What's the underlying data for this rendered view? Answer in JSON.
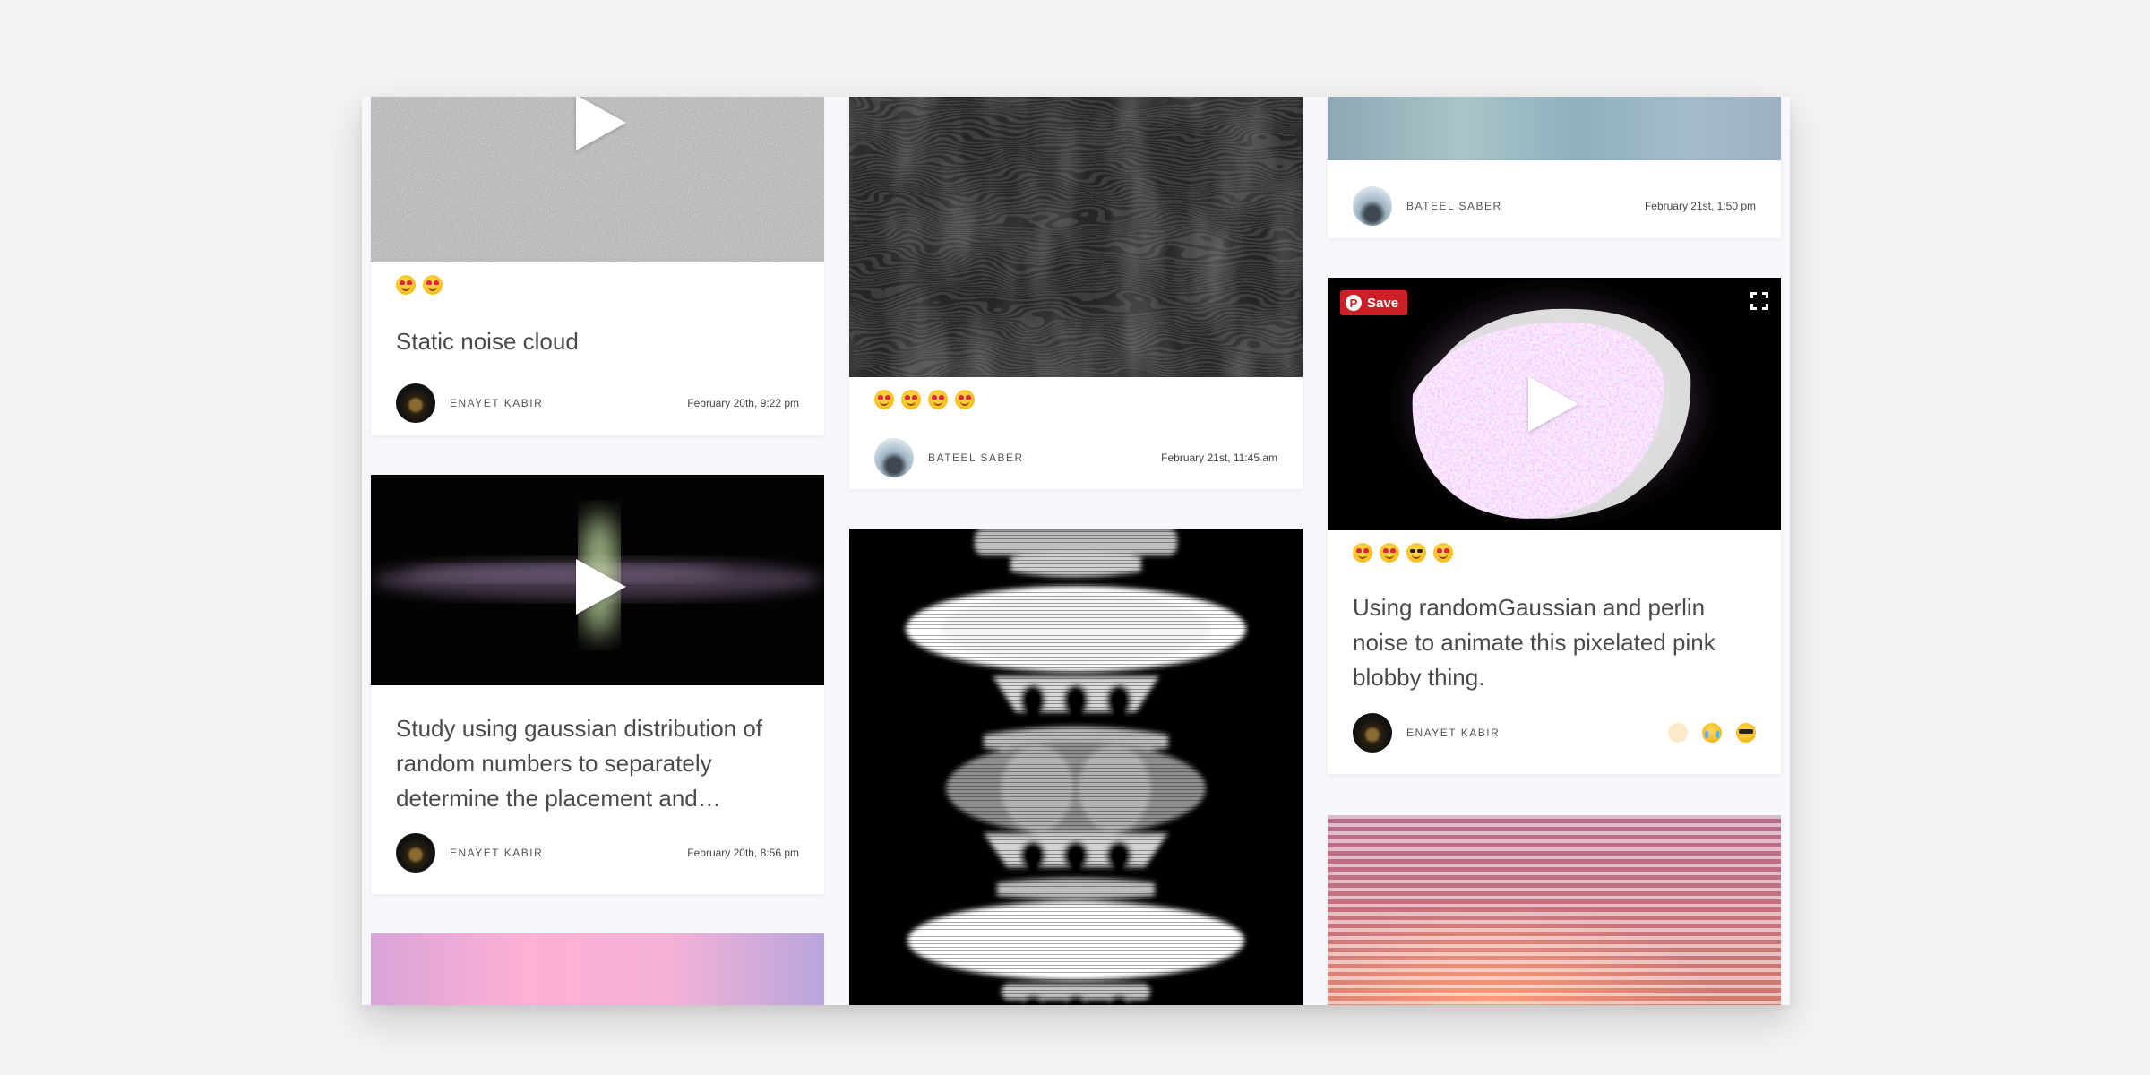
{
  "columns": [
    {
      "cards": [
        {
          "media": "static-noise",
          "has_play": true,
          "emojis": [
            "heart-eyes-emoji",
            "heart-eyes-emoji"
          ],
          "title": "Static noise cloud",
          "author": "ENAYET KABIR",
          "date": "February 20th, 9:22 pm"
        },
        {
          "media": "gaussian-dots",
          "has_play": true,
          "title": "Study using gaussian distribution of random numbers to separately determine the placement and…",
          "author": "ENAYET KABIR",
          "date": "February 20th, 8:56 pm"
        },
        {
          "media": "pink-gradient"
        }
      ]
    },
    {
      "cards": [
        {
          "media": "dark-waves",
          "emojis": [
            "heart-eyes-emoji",
            "heart-eyes-emoji",
            "heart-eyes-emoji",
            "heart-eyes-emoji"
          ],
          "author": "BATEEL SABER",
          "date": "February 21st, 11:45 am"
        },
        {
          "media": "symmetric-totem"
        }
      ]
    },
    {
      "cards": [
        {
          "media": "teal-blur",
          "author": "BATEEL SABER",
          "date": "February 21st, 1:50 pm"
        },
        {
          "media": "pink-blob",
          "has_play": true,
          "save_label": "Save",
          "emojis": [
            "heart-eyes-emoji",
            "heart-eyes-emoji",
            "sunglasses-emoji",
            "heart-eyes-emoji"
          ],
          "title": "Using randomGaussian and perlin noise to animate this pixelated pink blobby thing.",
          "author": "ENAYET KABIR",
          "reactions": [
            "faded-smile-icon",
            "crying-laughing-icon",
            "sunglasses-icon"
          ]
        },
        {
          "media": "pink-stripes"
        }
      ]
    }
  ],
  "colors": {
    "page_bg": "#f3f3f3",
    "card_bg": "#ffffff",
    "save_red": "#cb2027",
    "title_text": "#4a4a4a"
  }
}
